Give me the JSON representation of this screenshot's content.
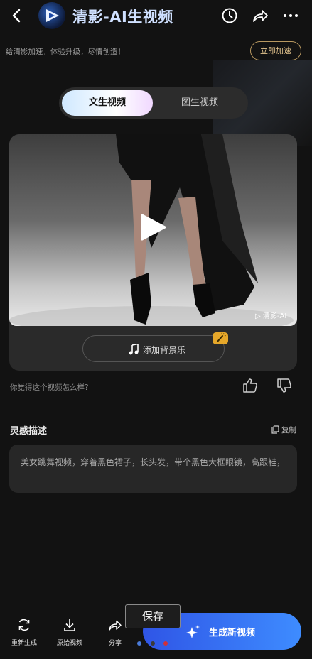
{
  "header": {
    "title": "清影-AI生视频",
    "back_icon": "chevron-left-icon",
    "history_icon": "clock-icon",
    "share_icon": "share-icon",
    "more_icon": "more-horizontal-icon"
  },
  "promo": {
    "text": "给清影加速，体验升级，尽情创造！",
    "button": "立即加速",
    "accent": "#e2c38d"
  },
  "tabs": [
    {
      "label": "文生视频",
      "active": true
    },
    {
      "label": "图生视频",
      "active": false
    }
  ],
  "video": {
    "watermark": "清影-AI",
    "play_icon": "play-icon",
    "music_button": "添加背景乐",
    "music_icon": "music-note-icon",
    "badge_icon": "magic-wand-icon"
  },
  "feedback": {
    "question": "你觉得这个视频怎么样?",
    "like_icon": "thumbs-up-icon",
    "dislike_icon": "thumbs-down-icon"
  },
  "inspiration": {
    "title": "灵感描述",
    "copy_label": "复制",
    "text": "美女跳舞视频，穿着黑色裙子，长头发，带个黑色大框眼镜，高跟鞋，"
  },
  "bottom": {
    "items": [
      {
        "label": "重新生成",
        "icon": "refresh-icon"
      },
      {
        "label": "原始视频",
        "icon": "download-icon"
      },
      {
        "label": "分享",
        "icon": "share-icon"
      }
    ],
    "generate_label": "生成新视频",
    "save_popup": "保存",
    "brand_blue": "#3e8cff"
  }
}
